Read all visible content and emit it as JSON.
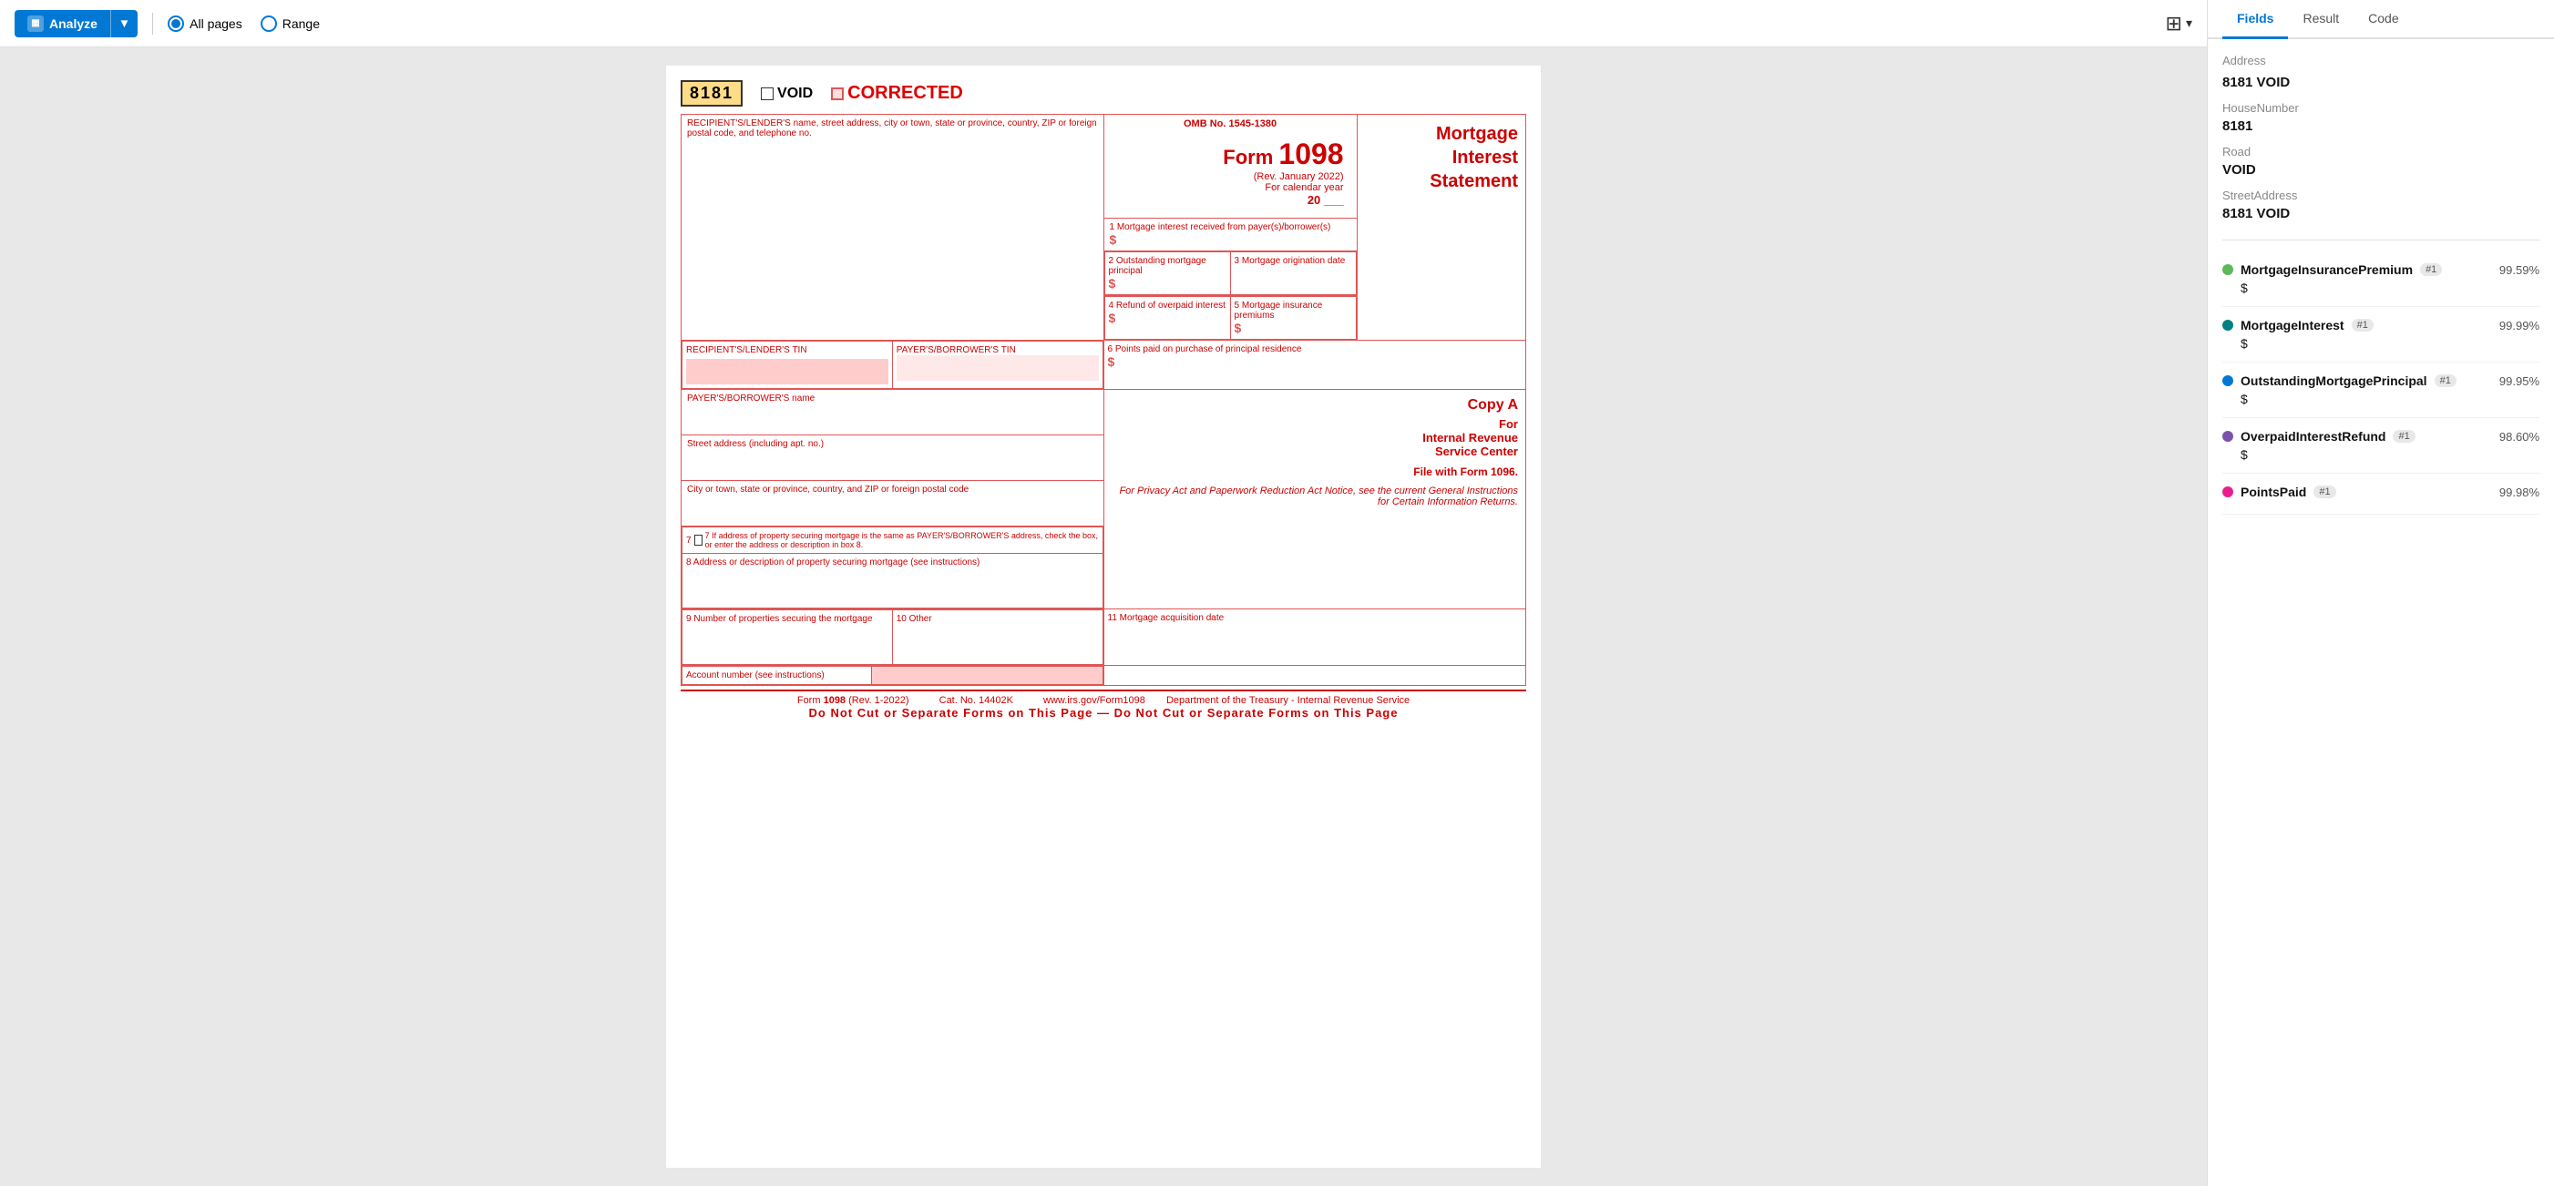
{
  "toolbar": {
    "analyze_label": "Analyze",
    "dropdown_icon": "▼",
    "all_pages_label": "All pages",
    "range_label": "Range",
    "layers_icon": "⊞",
    "layers_chevron": "▾"
  },
  "form": {
    "id_number": "8181",
    "void_label": "VOID",
    "corrected_label": "CORRECTED",
    "omb_number": "OMB No. 1545-1380",
    "form_number": "1098",
    "form_title_line1": "Mortgage",
    "form_title_line2": "Interest",
    "form_title_line3": "Statement",
    "rev_date": "(Rev. January 2022)",
    "calendar_year": "For calendar year",
    "calendar_year_value": "20 ___",
    "copy_a": "Copy A",
    "for_irs": "For",
    "irs_center": "Internal Revenue",
    "service_center": "Service Center",
    "file_with": "File with Form 1096.",
    "privacy_notice": "For Privacy Act and Paperwork Reduction Act Notice, see the current General Instructions for Certain Information Returns.",
    "recipient_label": "RECIPIENT'S/LENDER'S name, street address, city or town, state or province, country, ZIP or foreign postal code, and telephone no.",
    "recipient_tin_label": "RECIPIENT'S/LENDER'S TIN",
    "payer_tin_label": "PAYER'S/BORROWER'S TIN",
    "payer_name_label": "PAYER'S/BORROWER'S name",
    "street_label": "Street address (including apt. no.)",
    "city_label": "City or town, state or province, country, and ZIP or foreign postal code",
    "box1_label": "1 Mortgage interest received from payer(s)/borrower(s)",
    "box2_label": "2 Outstanding mortgage principal",
    "box3_label": "3 Mortgage origination date",
    "box4_label": "4 Refund of overpaid interest",
    "box5_label": "5 Mortgage insurance premiums",
    "box6_label": "6 Points paid on purchase of principal residence",
    "box7_label": "7  If address of property securing mortgage is the same as PAYER'S/BORROWER'S address, check the box, or enter the address or description in box 8.",
    "box8_label": "8 Address or description of property securing mortgage (see instructions)",
    "box9_label": "9 Number of properties securing the mortgage",
    "box10_label": "10 Other",
    "box11_label": "11 Mortgage acquisition date",
    "account_label": "Account number (see instructions)",
    "footer_form": "Form 1098 (Rev. 1-2022)",
    "footer_cat": "Cat. No. 14402K",
    "footer_url": "www.irs.gov/Form1098",
    "footer_dept": "Department of the Treasury - Internal Revenue Service",
    "footer_warning": "Do Not Cut or Separate Forms on This Page  —  Do Not Cut or Separate Forms on This Page"
  },
  "right_panel": {
    "tabs": [
      {
        "label": "Fields",
        "active": true
      },
      {
        "label": "Result",
        "active": false
      },
      {
        "label": "Code",
        "active": false
      }
    ],
    "address_section": {
      "title": "Address",
      "fields": [
        {
          "label": "8181 VOID",
          "sub_title": "HouseNumber",
          "sub_value": "8181"
        },
        {
          "label": "Road",
          "value": "VOID"
        },
        {
          "label": "StreetAddress",
          "value": "8181 VOID"
        }
      ]
    },
    "fields": [
      {
        "name": "MortgageInsurancePremium",
        "badge": "#1",
        "confidence": "99.59%",
        "value": "$",
        "dot_color": "green"
      },
      {
        "name": "MortgageInterest",
        "badge": "#1",
        "confidence": "99.99%",
        "value": "$",
        "dot_color": "teal"
      },
      {
        "name": "OutstandingMortgagePrincipal",
        "badge": "#1",
        "confidence": "99.95%",
        "value": "$",
        "dot_color": "blue"
      },
      {
        "name": "OverpaidInterestRefund",
        "badge": "#1",
        "confidence": "98.60%",
        "value": "$",
        "dot_color": "purple"
      },
      {
        "name": "PointsPaid",
        "badge": "#1",
        "confidence": "99.98%",
        "value": "",
        "dot_color": "pink"
      }
    ]
  }
}
